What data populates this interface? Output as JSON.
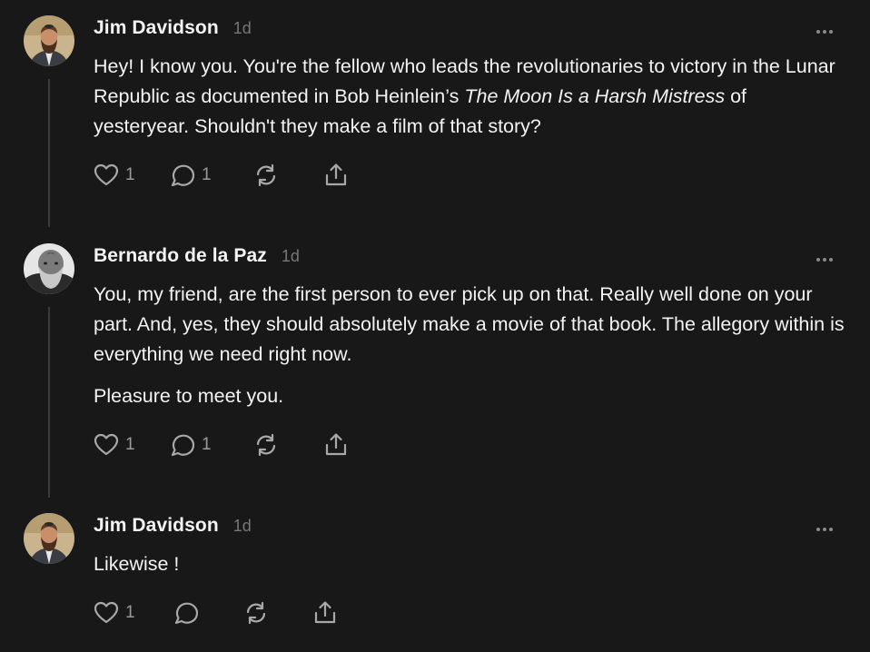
{
  "posts": [
    {
      "author": "Jim Davidson",
      "time": "1d",
      "paragraphs_text": [
        "Hey! I know you. You're the fellow who leads the revolutionaries to victory in the Lunar Republic as documented in Bob Heinlein’s ",
        "The Moon Is a Harsh Mistress",
        " of yesteryear. Shouldn't they make a film of that story?"
      ],
      "likes": "1",
      "replies": "1",
      "avatar_icon": "bearded-man-avatar"
    },
    {
      "author": "Bernardo de la Paz",
      "time": "1d",
      "paragraphs": [
        "You, my friend, are the first person to ever pick up on that. Really well done on your part. And, yes, they should absolutely make a movie of that book. The allegory within is everything we need right now.",
        "Pleasure to meet you."
      ],
      "likes": "1",
      "replies": "1",
      "avatar_icon": "bald-bearded-man-avatar"
    },
    {
      "author": "Jim Davidson",
      "time": "1d",
      "paragraphs": [
        "Likewise !"
      ],
      "likes": "1",
      "replies": "",
      "avatar_icon": "bearded-man-avatar"
    }
  ],
  "icons": [
    "heart-icon",
    "comment-icon",
    "repost-icon",
    "share-icon",
    "more-options-icon"
  ],
  "colors": {
    "background": "#181818",
    "text": "#f3f3f3",
    "muted": "#777777",
    "icon": "#a8a8a8",
    "thread_line": "#3a3a3a"
  }
}
